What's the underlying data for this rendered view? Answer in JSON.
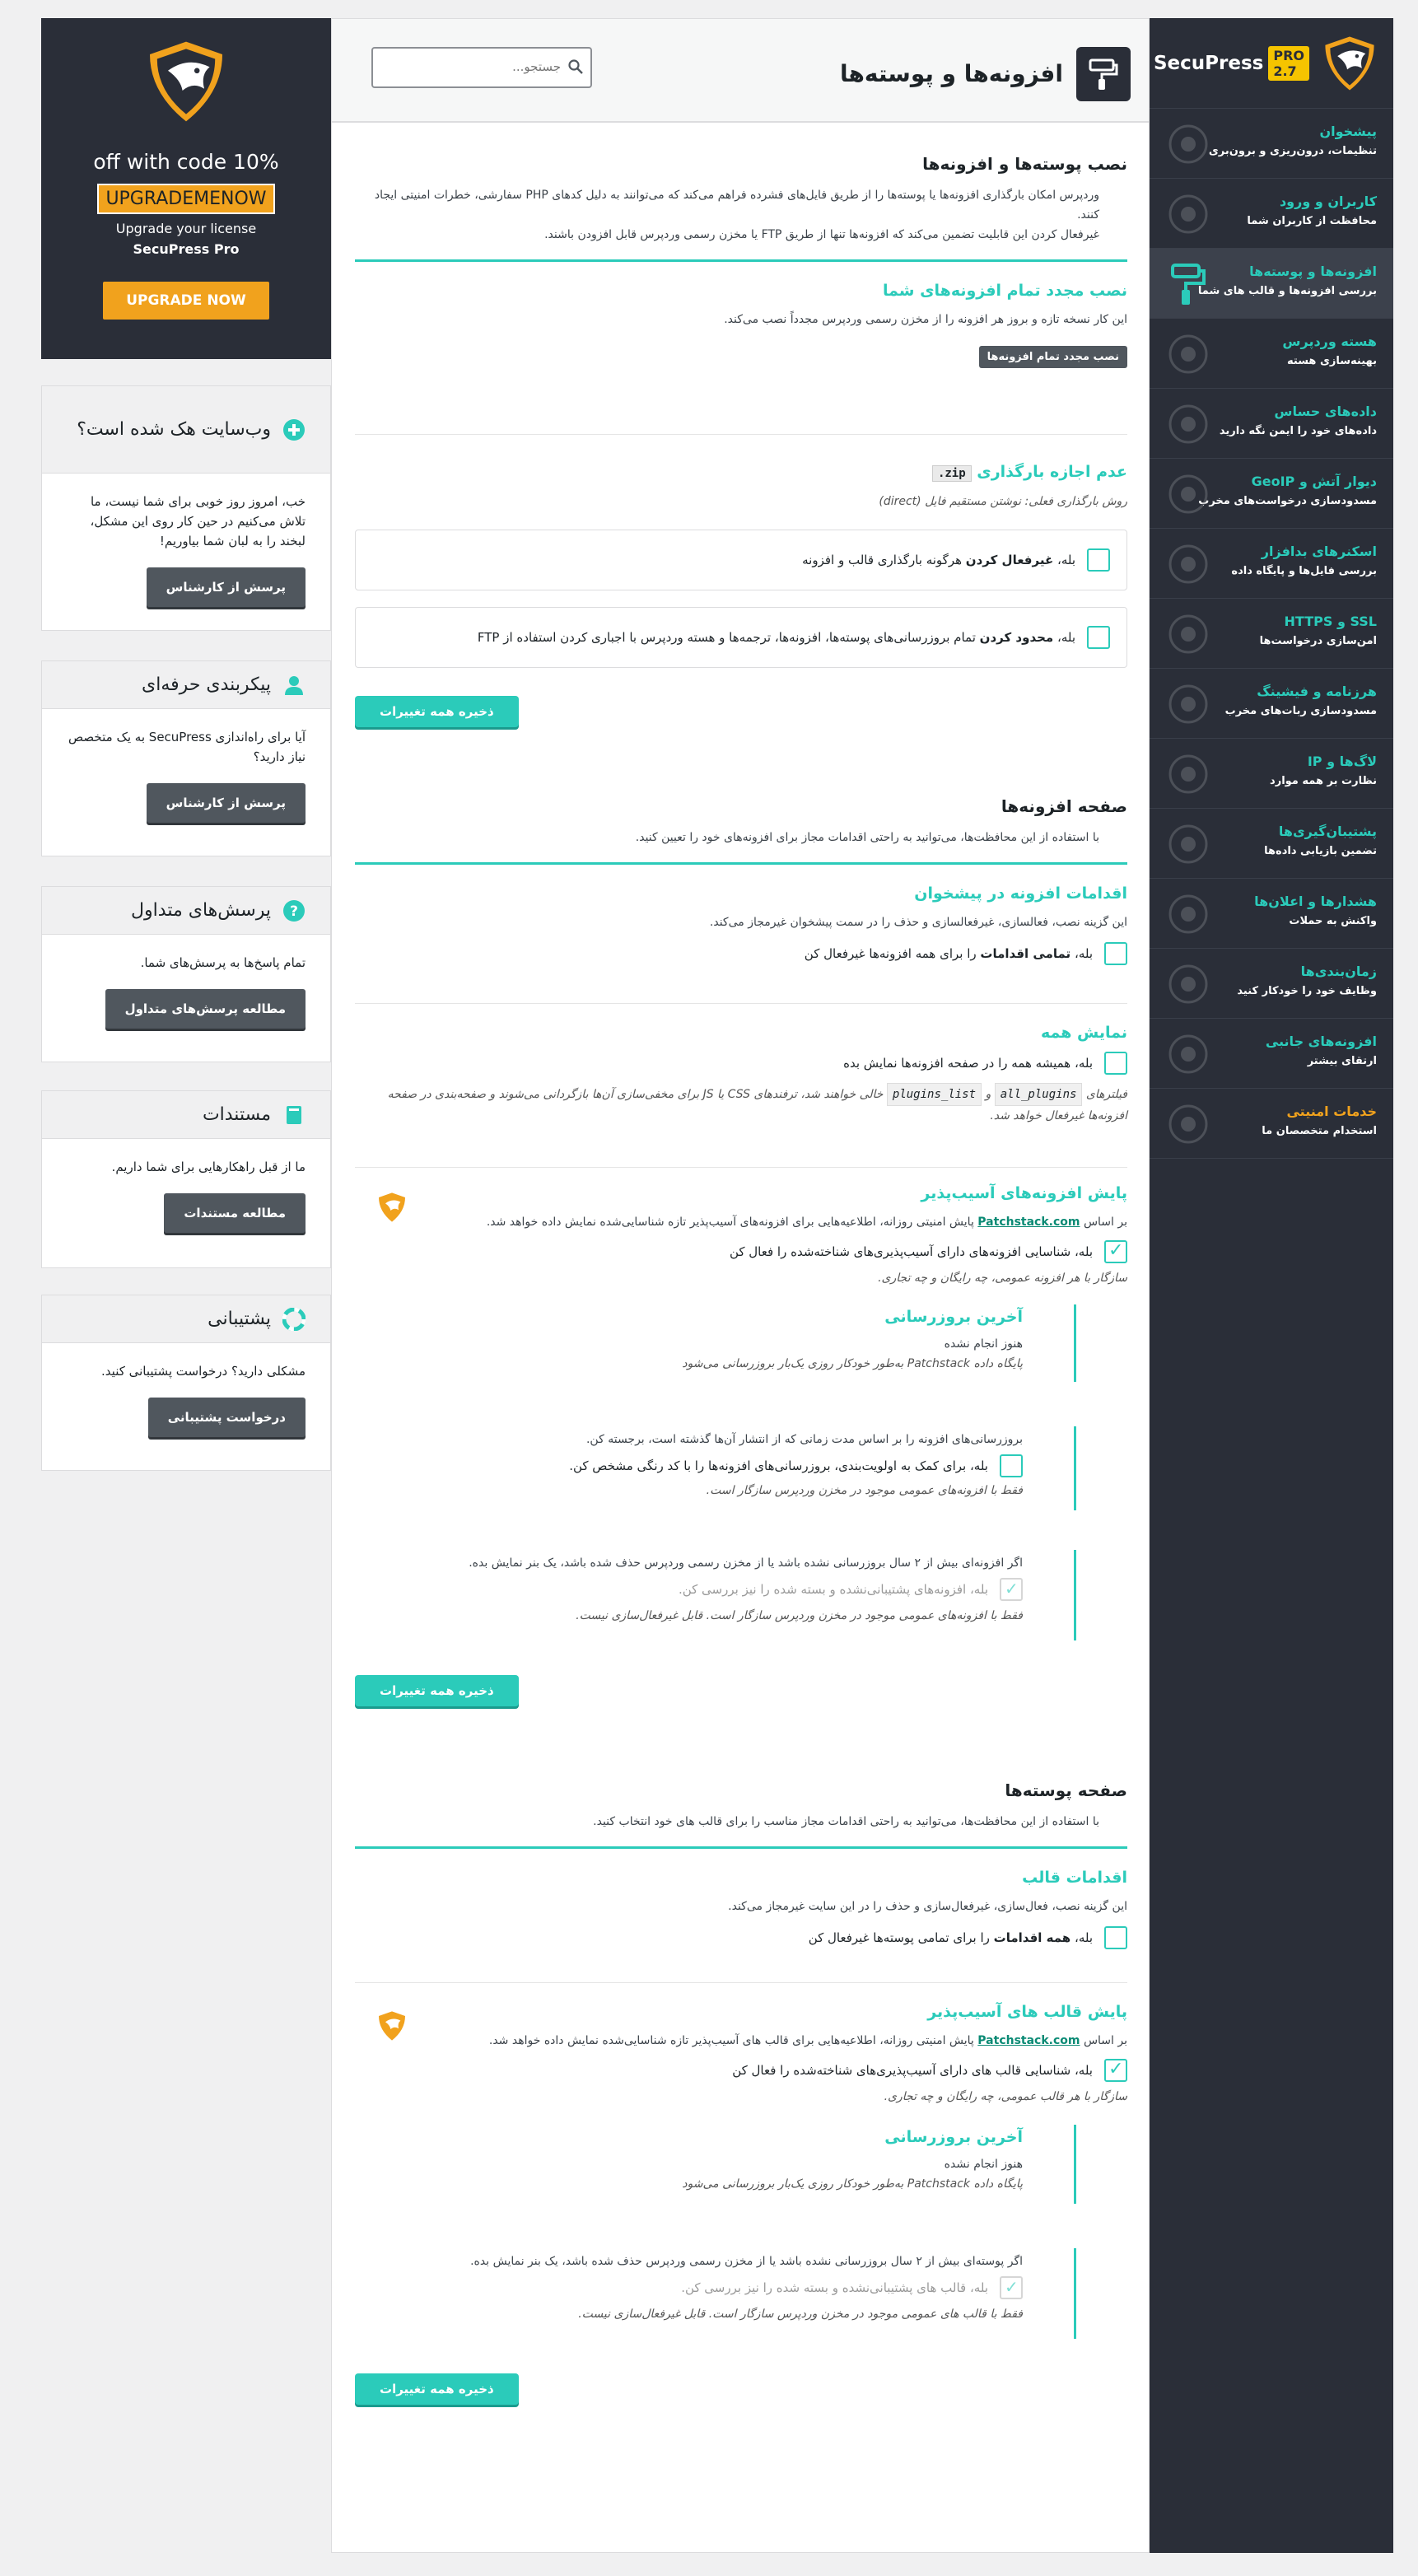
{
  "nav": {
    "brand": "SecuPress",
    "badge": "PRO 2.7",
    "items": [
      {
        "title": "پیشخوان",
        "sub": "تنظیمات، درون‌ریزی و برون‌بری",
        "icon": "dashboard-icon"
      },
      {
        "title": "کاربران و ورود",
        "sub": "محافظت از کاربران شما",
        "icon": "users-icon"
      },
      {
        "title": "افزونه‌ها و پوسته‌ها",
        "sub": "بررسی افزونه‌ها و قالب های شما",
        "icon": "paint-roller-icon"
      },
      {
        "title": "هسته وردپرس",
        "sub": "بهینه‌سازی هسته",
        "icon": "wordpress-icon"
      },
      {
        "title": "داده‌های حساس",
        "sub": "داده‌های خود را ایمن نگه دارید",
        "icon": "document-icon"
      },
      {
        "title": "دیوار آتش و GeoIP",
        "sub": "مسدودسازی درخواست‌های مخرب",
        "icon": "shield-icon"
      },
      {
        "title": "اسکنرهای بدافزار",
        "sub": "بررسی فایل‌ها و پایگاه داده",
        "icon": "radar-icon"
      },
      {
        "title": "SSL و HTTPS",
        "sub": "امن‌سازی درخواست‌ها",
        "icon": "lock-icon"
      },
      {
        "title": "هرزنامه و فیشینگ",
        "sub": "مسدودسازی ربات‌های مخرب",
        "icon": "envelope-icon"
      },
      {
        "title": "لاگ‌ها و IP",
        "sub": "نظارت بر همه موارد",
        "icon": "log-file-icon"
      },
      {
        "title": "پشتیبان‌گیری‌ها",
        "sub": "تضمین بازیابی داده‌ها",
        "icon": "archive-icon"
      },
      {
        "title": "هشدارها و اعلان‌ها",
        "sub": "واکنش به حملات",
        "icon": "bell-icon"
      },
      {
        "title": "زمان‌بندی‌ها",
        "sub": "وظایف خود را خودکار کنید",
        "icon": "calendar-icon"
      },
      {
        "title": "افزونه‌های جانبی",
        "sub": "ارتقای بیشتر",
        "icon": "gears-icon"
      },
      {
        "title": "خدمات امنیتی",
        "sub": "استخدام متخصصان ما",
        "icon": "expert-icon"
      }
    ]
  },
  "header": {
    "title": "افزونه‌ها و پوسته‌ها",
    "search_placeholder": "جستجو..."
  },
  "install": {
    "title": "نصب پوسته‌ها و افزونه‌ها",
    "desc1": "وردپرس امکان بارگذاری افزونه‌ها یا پوسته‌ها را از طریق فایل‌های فشرده فراهم می‌کند که می‌توانند به دلیل کدهای PHP سفارشی، خطرات امنیتی ایجاد کنند.",
    "desc2": "غیرفعال کردن این قابلیت تضمین می‌کند که افزونه‌ها تنها از طریق FTP یا مخزن رسمی وردپرس قابل افزودن باشند.",
    "reinstall_title": "نصب مجدد تمام افزونه‌های شما",
    "reinstall_desc": "این کار نسخه تازه و بروز هر افزونه را از مخزن رسمی وردپرس مجدداً نصب می‌کند.",
    "reinstall_btn": "نصب مجدد تمام افزونه‌ها",
    "zip_title": "عدم اجازه بارگذاری",
    "zip_code": ".zip",
    "zip_method": "روش بارگذاری فعلی: نوشتن مستقیم فایل (direct)",
    "opt1_prefix": "بله، ",
    "opt1_bold": "غیرفعال کردن",
    "opt1_rest": " هرگونه بارگذاری قالب و افزونه",
    "opt2_prefix": "بله، ",
    "opt2_bold": "محدود کردن",
    "opt2_rest": " تمام بروزرسانی‌های پوسته‌ها، افزونه‌ها، ترجمه‌ها و هسته وردپرس با اجباری کردن استفاده از FTP",
    "save": "ذخیره همه تغییرات"
  },
  "plugins": {
    "title": "صفحه افزونه‌ها",
    "desc": "با استفاده از این محافظت‌ها، می‌توانید به راحتی اقدامات مجاز برای افزونه‌های خود را تعیین کنید.",
    "actions_title": "اقدامات افزونه در پیشخوان",
    "actions_desc": "این گزینه نصب، فعالسازی، غیرفعالسازی و حذف را در سمت پیشخوان غیرمجاز می‌کند.",
    "actions_opt_prefix": "بله، ",
    "actions_opt_bold": "تمامی اقدامات",
    "actions_opt_rest": " را برای همه افزونه‌ها غیرفعال کن",
    "showall_title": "نمایش همه",
    "showall_opt": "بله، همیشه همه را در صفحه افزونه‌ها نمایش بده",
    "filters_label": "فیلترهای",
    "filter1": "all_plugins",
    "filter_and": "و",
    "filter2": "plugins_list",
    "filters_rest": "خالی خواهند شد، ترفندهای CSS یا JS برای مخفی‌سازی آن‌ها بازگردانی می‌شوند و صفحه‌بندی در صفحه افزونه‌ها غیرفعال خواهد شد.",
    "vuln_title": "پایش افزونه‌های آسیب‌پذیر",
    "vuln_desc_pre": "بر اساس",
    "vuln_link": "Patchstack.com",
    "vuln_desc_post": "پایش امنیتی روزانه، اطلاعیه‌هایی برای افزونه‌های آسیب‌پذیر تازه شناسایی‌شده نمایش داده خواهد شد.",
    "vuln_opt": "بله، شناسایی افزونه‌های دارای آسیب‌پذیری‌های شناخته‌شده را فعال کن",
    "vuln_note": "سازگار با هر افزونه عمومی، چه رایگان و چه تجاری.",
    "last_title": "آخرین بروزرسانی",
    "last_status": "هنوز انجام نشده",
    "last_note": "پایگاه داده Patchstack به‌طور خودکار روزی یک‌بار بروزرسانی می‌شود",
    "age_desc": "بروزرسانی‌های افزونه را بر اساس مدت زمانی که از انتشار آن‌ها گذشته است، برجسته کن.",
    "age_opt": "بله، برای کمک به اولویت‌بندی، بروزرسانی‌های افزونه‌ها را با کد رنگی مشخص کن.",
    "age_note": "فقط با افزونه‌های عمومی موجود در مخزن وردپرس سازگار است.",
    "old_desc": "اگر افزونه‌ای بیش از ۲ سال بروزرسانی نشده باشد یا از مخزن رسمی وردپرس حذف شده باشد، یک بنر نمایش بده.",
    "old_opt": "بله، افزونه‌های پشتیبانی‌نشده و بسته شده را نیز بررسی کن.",
    "old_note": "فقط با افزونه‌های عمومی موجود در مخزن وردپرس سازگار است. قابل غیرفعال‌سازی نیست.",
    "save": "ذخیره همه تغییرات"
  },
  "themes": {
    "title": "صفحه پوسته‌ها",
    "desc": "با استفاده از این محافظت‌ها، می‌توانید به راحتی اقدامات مجاز مناسب را برای قالب های خود انتخاب کنید.",
    "actions_title": "اقدامات قالب",
    "actions_desc": "این گزینه نصب، فعال‌سازی، غیرفعال‌سازی و حذف را در این سایت غیرمجاز می‌کند.",
    "actions_opt_prefix": "بله، ",
    "actions_opt_bold": "همه اقدامات",
    "actions_opt_rest": " را برای تمامی پوسته‌ها غیرفعال کن",
    "vuln_title": "پایش قالب های آسیب‌پذیر",
    "vuln_desc_pre": "بر اساس",
    "vuln_link": "Patchstack.com",
    "vuln_desc_post": "پایش امنیتی روزانه، اطلاعیه‌هایی برای قالب های آسیب‌پذیر تازه شناسایی‌شده نمایش داده خواهد شد.",
    "vuln_opt": "بله، شناسایی قالب های دارای آسیب‌پذیری‌های شناخته‌شده را فعال کن",
    "vuln_note": "سازگار با هر قالب عمومی، چه رایگان و چه تجاری.",
    "last_title": "آخرین بروزرسانی",
    "last_status": "هنوز انجام نشده",
    "last_note": "پایگاه داده Patchstack به‌طور خودکار روزی یک‌بار بروزرسانی می‌شود",
    "old_desc": "اگر پوسته‌ای بیش از ۲ سال بروزرسانی نشده باشد یا از مخزن رسمی وردپرس حذف شده باشد، یک بنر نمایش بده.",
    "old_opt": "بله، قالب های پشتیبانی‌نشده و بسته شده را نیز بررسی کن.",
    "old_note": "فقط با قالب های عمومی موجود در مخزن وردپرس سازگار است. قابل غیرفعال‌سازی نیست.",
    "save": "ذخیره همه تغییرات"
  },
  "promo": {
    "off": "off with code 10%",
    "code": "UPGRADEMENOW",
    "upgrade_line": "Upgrade your license",
    "product": "SecuPress Pro",
    "button": "UPGRADE NOW"
  },
  "widgets": {
    "hacked": {
      "title": "وب‌سایت هک شده است؟",
      "body": "خب، امروز روز خوبی برای شما نیست، ما تلاش می‌کنیم در حین کار روی این مشکل، لبخند را به لبان شما بیاوریم!",
      "button": "پرسش از کارشناس"
    },
    "pro_config": {
      "title": "پیکربندی حرفه‌ای",
      "body": "آیا برای راه‌اندازی SecuPress به یک متخصص نیاز دارید؟",
      "button": "پرسش از کارشناس"
    },
    "faq": {
      "title": "پرسش‌های متداول",
      "body": "تمام پاسخ‌ها به پرسش‌های شما.",
      "button": "مطالعه پرسش‌های متداول"
    },
    "docs": {
      "title": "مستندات",
      "body": "ما از قبل راهکارهایی برای شما داریم.",
      "button": "مطالعه مستندات"
    },
    "support": {
      "title": "پشتیبانی",
      "body": "مشکلی دارید؟ درخواست پشتیبانی کنید.",
      "button": "درخواست پشتیبانی"
    }
  },
  "colors": {
    "accent": "#2bcbba",
    "dark": "#2a2e38",
    "orange": "#f1a21d"
  }
}
